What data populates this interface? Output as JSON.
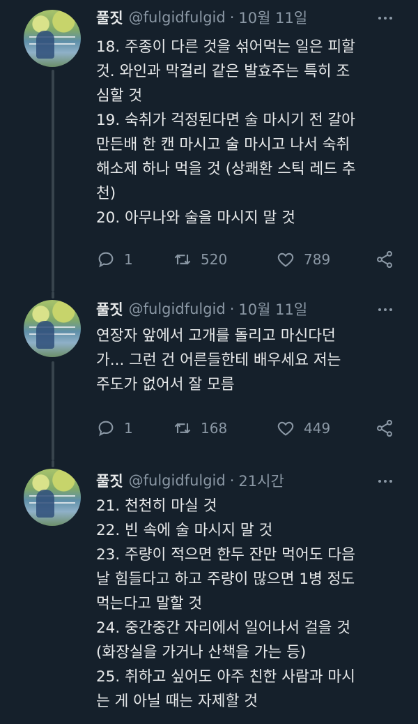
{
  "tweets": [
    {
      "author_name": "풀짓",
      "handle": "@fulgidfulgid",
      "separator": "·",
      "time": "10월 11일",
      "text": "18. 주종이 다른 것을 섞어먹는 일은 피할\n것. 와인과 막걸리 같은 발효주는 특히 조\n심할 것\n19. 숙취가 걱정된다면 술 마시기 전 갈아\n만든배 한 캔 마시고 술 마시고 나서 숙취\n해소제 하나 먹을 것 (상쾌환 스틱 레드 추\n천)\n20. 아무나와 술을 마시지 말 것",
      "replies": "1",
      "retweets": "520",
      "likes": "789"
    },
    {
      "author_name": "풀짓",
      "handle": "@fulgidfulgid",
      "separator": "·",
      "time": "10월 11일",
      "text": "연장자 앞에서 고개를 돌리고 마신다던\n가... 그런 건 어른들한테 배우세요 저는\n주도가 없어서 잘 모름",
      "replies": "1",
      "retweets": "168",
      "likes": "449"
    },
    {
      "author_name": "풀짓",
      "handle": "@fulgidfulgid",
      "separator": "·",
      "time": "21시간",
      "text": "21. 천천히 마실 것\n22. 빈 속에 술 마시지 말 것\n23. 주량이 적으면 한두 잔만 먹어도 다음\n날 힘들다고 하고 주량이 많으면 1병 정도\n먹는다고 말할 것\n24. 중간중간 자리에서 일어나서 걸을 것\n(화장실을 가거나 산책을 가는 등)\n25. 취하고 싶어도 아주 친한 사람과 마시\n는 게 아닐 때는 자제할 것"
    }
  ],
  "colors": {
    "background": "#15202b",
    "text": "#e7e9ea",
    "muted": "#8b98a5",
    "divider": "#38444d"
  },
  "icons": [
    "reply-icon",
    "retweet-icon",
    "like-icon",
    "share-icon",
    "more-icon"
  ]
}
